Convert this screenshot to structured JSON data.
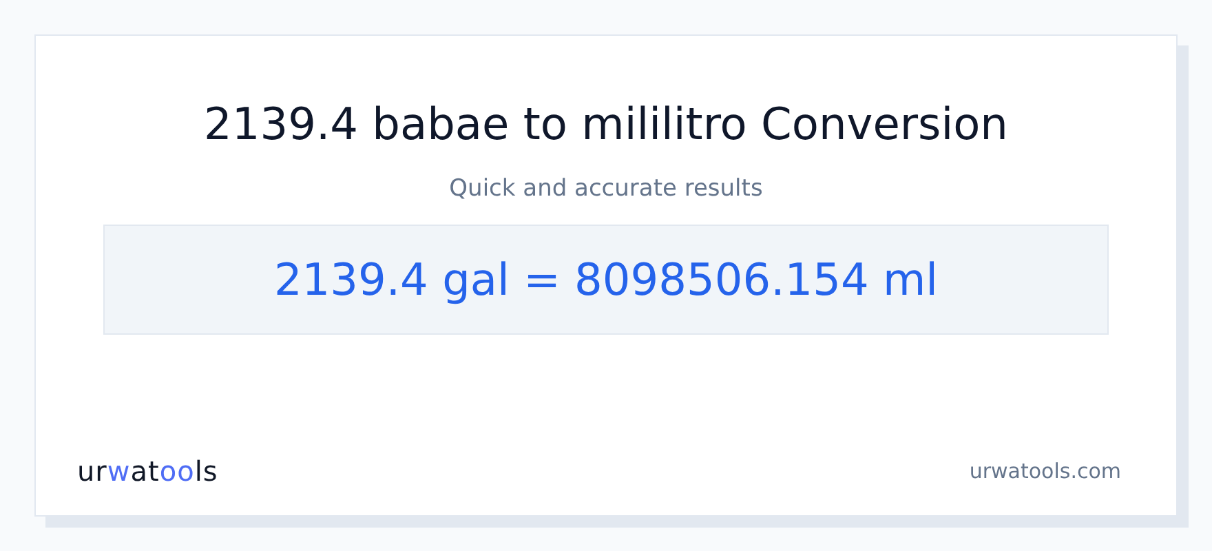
{
  "title": "2139.4 babae to mililitro Conversion",
  "subtitle": "Quick and accurate results",
  "result": "2139.4 gal = 8098506.154 ml",
  "logo": [
    {
      "text": "ur",
      "accent": false
    },
    {
      "text": "w",
      "accent": true
    },
    {
      "text": "at",
      "accent": false
    },
    {
      "text": "oo",
      "accent": true
    },
    {
      "text": "ls",
      "accent": false
    }
  ],
  "site": "urwatools.com"
}
